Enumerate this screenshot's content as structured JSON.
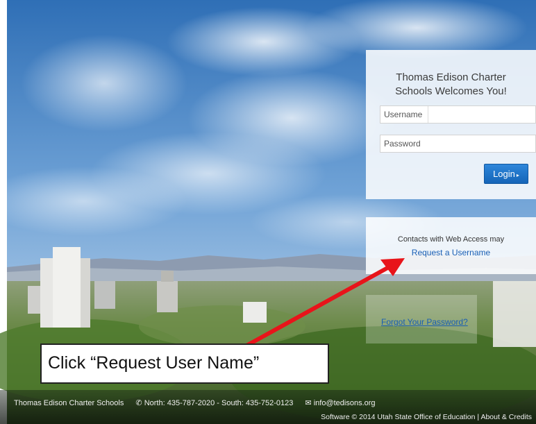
{
  "login": {
    "title_line1": "Thomas Edison Charter",
    "title_line2": "Schools Welcomes You!",
    "username_placeholder": "Username",
    "password_placeholder": "Password",
    "login_label": "Login",
    "login_caret": "▸"
  },
  "request": {
    "text": "Contacts with Web Access may",
    "link": "Request a Username"
  },
  "forgot": {
    "link": "Forgot Your Password?"
  },
  "callout": {
    "text": "Click “Request User Name”",
    "arrow_color": "#e8141a"
  },
  "footer": {
    "school": "Thomas Edison Charter Schools",
    "phone": "North: 435-787-2020 - South: 435-752-0123",
    "email": "info@tedisons.org",
    "software": "Software © 2014 Utah State Office of Education | About & Credits"
  },
  "colors": {
    "accent": "#1a5fb4",
    "button": "#1f75cc"
  }
}
